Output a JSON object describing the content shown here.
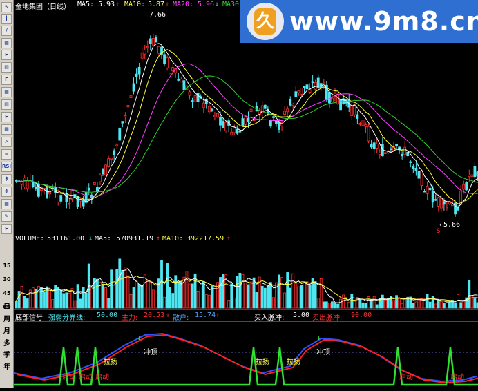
{
  "toolbar": {
    "icons": [
      "cursor-icon",
      "bar-icon",
      "line-icon",
      "grid-icon",
      "f10-icon",
      "chart-icon",
      "f10-icon",
      "grid-icon",
      "chart-icon",
      "f10-icon",
      "grid-icon",
      "zoom-icon",
      "ruler-icon",
      "rsi-icon",
      "sort-icon",
      "move-icon",
      "grid-icon",
      "pencil-icon",
      "fs-icon"
    ],
    "rsi_label": "RSI",
    "f_labels": [
      "F10",
      "F5",
      "FS"
    ],
    "periods": [
      "日",
      "周",
      "月",
      "多",
      "季",
      "年"
    ],
    "scale_labels": [
      "15",
      "30",
      "45",
      "60",
      "N"
    ]
  },
  "price_panel": {
    "stock_name": "金地集团（日线）",
    "ma5_label": "MA5:",
    "ma5_value": "5.93",
    "ma5_arrow": "↑",
    "ma10_label": "MA10:",
    "ma10_value": "5.87",
    "ma10_arrow": "↑",
    "ma20_label": "MA20:",
    "ma20_value": "5.96",
    "ma20_arrow": "↓",
    "ma30_label": "MA30",
    "high_label": "7.66",
    "low_label": "←5.66",
    "marker_s": "S",
    "colors": {
      "up": "#ff3030",
      "down": "#4ee6f0",
      "ma5": "#ffffff",
      "ma10": "#ffff40",
      "ma20": "#ff40ff",
      "ma30": "#30d030"
    }
  },
  "volume_panel": {
    "vol_label": "VOLUME:",
    "vol_value": "531161.00",
    "vol_arrow": "↓",
    "ma5_label": "MA5:",
    "ma5_value": "570931.19",
    "ma5_arrow": "↑",
    "ma10_label": "MA10:",
    "ma10_value": "392217.59",
    "ma10_arrow": "↑"
  },
  "signal_panel": {
    "title": "底部信号",
    "strong_label": "强弱分界线:",
    "strong_value": "50.00",
    "main_label": "主力:",
    "main_value": "20.53",
    "main_arrow": "↑",
    "retail_label": "散户:",
    "retail_value": "15.74",
    "retail_arrow": "↑",
    "buy_label": "买入脉冲:",
    "buy_value": "5.00",
    "sell_label": "卖出脉冲:",
    "sell_value": "90.00",
    "annotations": [
      "冲顶",
      "冲顶",
      "拉扬",
      "拉扬",
      "拉扬",
      "启动",
      "启动",
      "启动",
      "启动",
      "启动"
    ]
  },
  "logo": {
    "text": "www.9m8.cn",
    "seal": "久"
  }
}
